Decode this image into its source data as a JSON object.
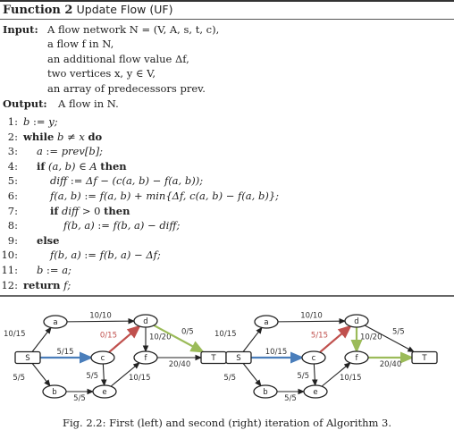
{
  "algorithm": {
    "label": "Function 2",
    "name": "Update Flow (UF)",
    "input_label": "Input:",
    "inputs": [
      "A flow network N = (V, A, s, t, c),",
      "a flow f in N,",
      "an additional flow value Δf,",
      "two vertices x, y ∈ V,",
      "an array of predecessors prev."
    ],
    "output_label": "Output:",
    "output": "A flow in N.",
    "lines": [
      {
        "n": "1:",
        "indent": 0,
        "text": "b := y;"
      },
      {
        "n": "2:",
        "indent": 0,
        "text": "while b ≠ x do"
      },
      {
        "n": "3:",
        "indent": 1,
        "text": "a := prev[b];"
      },
      {
        "n": "4:",
        "indent": 1,
        "text": "if (a, b) ∈ A then"
      },
      {
        "n": "5:",
        "indent": 2,
        "text": "diff := Δf − (c(a, b) − f(a, b));"
      },
      {
        "n": "6:",
        "indent": 2,
        "text": "f(a, b) := f(a, b) + min{Δf, c(a, b) − f(a, b)};"
      },
      {
        "n": "7:",
        "indent": 2,
        "text": "if diff > 0 then"
      },
      {
        "n": "8:",
        "indent": 3,
        "text": "f(b, a) := f(b, a) − diff;"
      },
      {
        "n": "9:",
        "indent": 1,
        "text": "else"
      },
      {
        "n": "10:",
        "indent": 2,
        "text": "f(b, a) := f(b, a) − Δf;"
      },
      {
        "n": "11:",
        "indent": 1,
        "text": "b := a;"
      },
      {
        "n": "12:",
        "indent": 0,
        "text": "return  f;"
      }
    ]
  },
  "colors": {
    "blue": "#4a7ebb",
    "red": "#c0504d",
    "green": "#9bbb59",
    "black": "#222222"
  },
  "figure": {
    "caption": "Fig. 2.2: First (left) and second (right) iteration of Algorithm 3.",
    "graphs": [
      {
        "name": "first-iteration",
        "nodes": [
          {
            "id": "S",
            "shape": "box"
          },
          {
            "id": "a",
            "shape": "ellipse"
          },
          {
            "id": "b",
            "shape": "ellipse"
          },
          {
            "id": "c",
            "shape": "ellipse"
          },
          {
            "id": "d",
            "shape": "ellipse"
          },
          {
            "id": "e",
            "shape": "ellipse"
          },
          {
            "id": "f",
            "shape": "ellipse"
          },
          {
            "id": "T",
            "shape": "box"
          }
        ],
        "edges": [
          {
            "from": "S",
            "to": "a",
            "label": "10/15",
            "color": "black"
          },
          {
            "from": "S",
            "to": "c",
            "label": "5/15",
            "color": "blue"
          },
          {
            "from": "S",
            "to": "b",
            "label": "5/5",
            "color": "black"
          },
          {
            "from": "a",
            "to": "d",
            "label": "10/10",
            "color": "black"
          },
          {
            "from": "c",
            "to": "d",
            "label": "0/15",
            "color": "red"
          },
          {
            "from": "c",
            "to": "e",
            "label": "5/5",
            "color": "black"
          },
          {
            "from": "b",
            "to": "e",
            "label": "5/5",
            "color": "black"
          },
          {
            "from": "d",
            "to": "f",
            "label": "10/20",
            "color": "black"
          },
          {
            "from": "d",
            "to": "T",
            "label": "0/5",
            "color": "green"
          },
          {
            "from": "e",
            "to": "f",
            "label": "10/15",
            "color": "black"
          },
          {
            "from": "f",
            "to": "T",
            "label": "20/40",
            "color": "black"
          }
        ]
      },
      {
        "name": "second-iteration",
        "nodes": [
          {
            "id": "S",
            "shape": "box"
          },
          {
            "id": "a",
            "shape": "ellipse"
          },
          {
            "id": "b",
            "shape": "ellipse"
          },
          {
            "id": "c",
            "shape": "ellipse"
          },
          {
            "id": "d",
            "shape": "ellipse"
          },
          {
            "id": "e",
            "shape": "ellipse"
          },
          {
            "id": "f",
            "shape": "ellipse"
          },
          {
            "id": "T",
            "shape": "box"
          }
        ],
        "edges": [
          {
            "from": "S",
            "to": "a",
            "label": "10/15",
            "color": "black"
          },
          {
            "from": "S",
            "to": "c",
            "label": "10/15",
            "color": "blue"
          },
          {
            "from": "S",
            "to": "b",
            "label": "5/5",
            "color": "black"
          },
          {
            "from": "a",
            "to": "d",
            "label": "10/10",
            "color": "black"
          },
          {
            "from": "c",
            "to": "d",
            "label": "5/15",
            "color": "red"
          },
          {
            "from": "c",
            "to": "e",
            "label": "5/5",
            "color": "black"
          },
          {
            "from": "b",
            "to": "e",
            "label": "5/5",
            "color": "black"
          },
          {
            "from": "d",
            "to": "f",
            "label": "10/20",
            "color": "green"
          },
          {
            "from": "d",
            "to": "T",
            "label": "5/5",
            "color": "black"
          },
          {
            "from": "e",
            "to": "f",
            "label": "10/15",
            "color": "black"
          },
          {
            "from": "f",
            "to": "T",
            "label": "20/40",
            "color": "green"
          }
        ]
      }
    ]
  }
}
